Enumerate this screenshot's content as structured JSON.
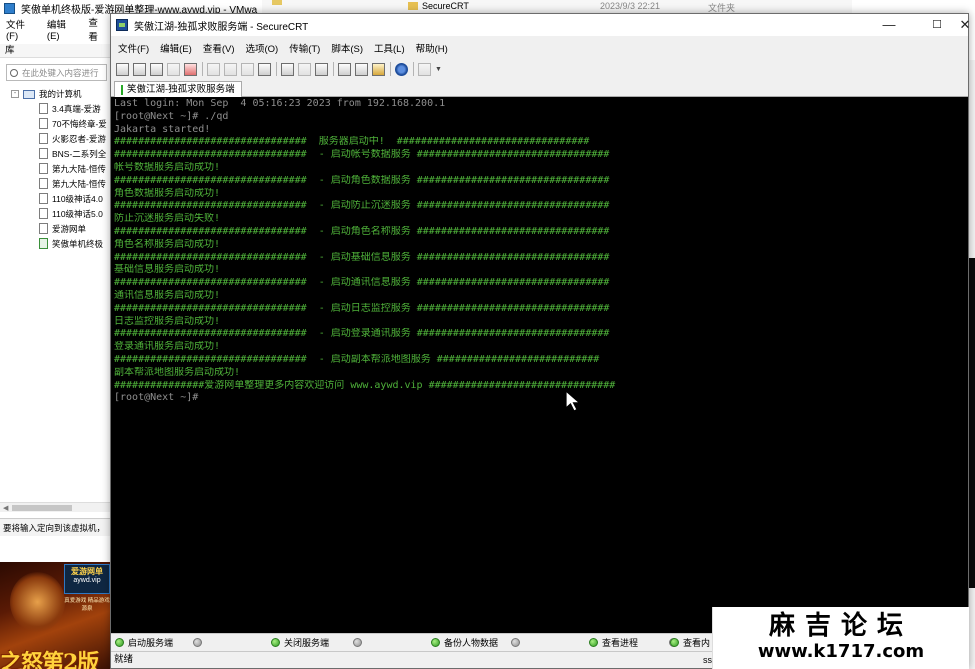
{
  "vmware": {
    "title": "笑傲单机终极版-爱游网单整理-www.aywd.vip - VMwa",
    "menu": [
      "文件(F)",
      "编辑(E)",
      "查看"
    ],
    "library_header": "库",
    "search_placeholder": "在此处键入内容进行",
    "tree_root": "我的计算机",
    "tree_items": [
      "3.4真端-爱游",
      "70不悔终章-爱",
      "火影忍者-爱游",
      "BNS-二系列全",
      "第九大陆-恒传",
      "第九大陆-恒传",
      "110级神话4.0",
      "110级神话5.0",
      "爱游网单",
      "笑傲单机终极"
    ],
    "status": "要将输入定向到该虚拟机，",
    "banner": {
      "logo_l1": "爱游网单",
      "logo_l2": "aywd.vip",
      "tagline": "真爱游戏 精品游戏源泉",
      "title": "之怒第2版"
    }
  },
  "explorer": {
    "name": "SecureCRT",
    "date": "2023/9/3 22:21",
    "type": "文件夹"
  },
  "securecrt": {
    "title": "笑傲江湖-独孤求败服务端 - SecureCRT",
    "menu": [
      "文件(F)",
      "编辑(E)",
      "查看(V)",
      "选项(O)",
      "传输(T)",
      "脚本(S)",
      "工具(L)",
      "帮助(H)"
    ],
    "tab_label": "笑傲江湖-独孤求败服务端",
    "terminal_lines": [
      {
        "t": "Last login: Mon Sep  4 05:16:23 2023 from 192.168.200.1",
        "c": "dim"
      },
      {
        "t": "[root@Next ~]# ./qd",
        "c": "dim"
      },
      {
        "t": "Jakarta started!",
        "c": "dim"
      },
      {
        "t": "################################  服务器启动中!  ################################",
        "c": "g"
      },
      {
        "t": "################################  - 启动帐号数据服务 ################################",
        "c": "g"
      },
      {
        "t": "帐号数据服务启动成功!",
        "c": "g"
      },
      {
        "t": "################################  - 启动角色数据服务 ################################",
        "c": "g"
      },
      {
        "t": "角色数据服务启动成功!",
        "c": "g"
      },
      {
        "t": "################################  - 启动防止沉迷服务 ################################",
        "c": "g"
      },
      {
        "t": "防止沉迷服务启动失败!",
        "c": "g"
      },
      {
        "t": "################################  - 启动角色名称服务 ################################",
        "c": "g"
      },
      {
        "t": "角色名称服务启动成功!",
        "c": "g"
      },
      {
        "t": "################################  - 启动基础信息服务 ################################",
        "c": "g"
      },
      {
        "t": "基础信息服务启动成功!",
        "c": "g"
      },
      {
        "t": "################################  - 启动通讯信息服务 ################################",
        "c": "g"
      },
      {
        "t": "通讯信息服务启动成功!",
        "c": "g"
      },
      {
        "t": "################################  - 启动日志监控服务 ################################",
        "c": "g"
      },
      {
        "t": "日志监控服务启动成功!",
        "c": "g"
      },
      {
        "t": "################################  - 启动登录通讯服务 ################################",
        "c": "g"
      },
      {
        "t": "登录通讯服务启动成功!",
        "c": "g"
      },
      {
        "t": "################################  - 启动副本帮派地图服务 ###########################",
        "c": "g"
      },
      {
        "t": "副本帮派地图服务启动成功!",
        "c": "g"
      },
      {
        "t": "###############爱游网单整理更多内容欢迎访问 www.aywd.vip ###############################",
        "c": "g"
      },
      {
        "t": "[root@Next ~]#",
        "c": "dim"
      }
    ],
    "buttons": [
      "启动服务端",
      "关闭服务端",
      "备份人物数据",
      "查看进程",
      "查看内"
    ],
    "status": "就绪",
    "status_right": "ssl"
  },
  "watermark": {
    "line1": "麻吉论坛",
    "line2": "www.k1717.com"
  }
}
